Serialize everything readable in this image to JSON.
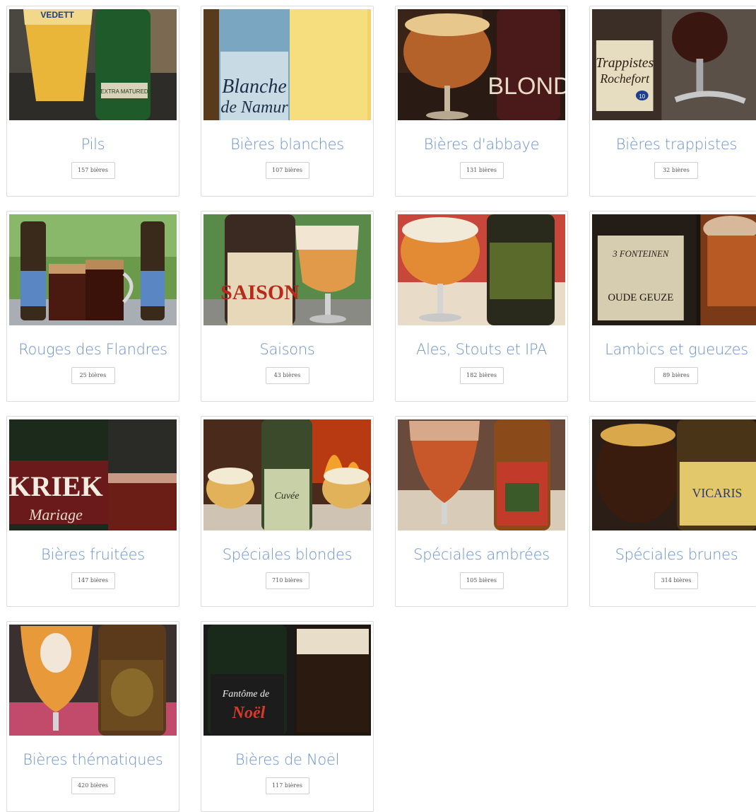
{
  "categories": [
    {
      "title": "Pils",
      "count": "157 bières"
    },
    {
      "title": "Bières blanches",
      "count": "107 bières"
    },
    {
      "title": "Bières d'abbaye",
      "count": "131 bières"
    },
    {
      "title": "Bières trappistes",
      "count": "32 bières"
    },
    {
      "title": "Rouges des Flandres",
      "count": "25 bières"
    },
    {
      "title": "Saisons",
      "count": "43 bières"
    },
    {
      "title": "Ales, Stouts et IPA",
      "count": "182 bières"
    },
    {
      "title": "Lambics et gueuzes",
      "count": "89 bières"
    },
    {
      "title": "Bières fruitées",
      "count": "147 bières"
    },
    {
      "title": "Spéciales blondes",
      "count": "710 bières"
    },
    {
      "title": "Spéciales ambrées",
      "count": "105 bières"
    },
    {
      "title": "Spéciales brunes",
      "count": "314 bières"
    },
    {
      "title": "Bières thématiques",
      "count": "420 bières"
    },
    {
      "title": "Bières de Noël",
      "count": "117 bières"
    }
  ],
  "photo_labels": {
    "pils_glass": "VEDETT",
    "pils_bottle": "EXTRA MATURED",
    "blanche_1": "Blanche",
    "blanche_2": "de Namur",
    "abbaye": "BLOND",
    "trappiste_1": "Trappistes",
    "trappiste_2": "Rochefort",
    "trappiste_3": "10",
    "saison": "SAISON",
    "lambic_1": "3 FONTEINEN",
    "lambic_2": "OUDE GEUZE",
    "kriek_1": "KRIEK",
    "kriek_2": "Mariage",
    "blonde": "Cuvée",
    "brune": "VICARIS",
    "noel_1": "Fantôme de",
    "noel_2": "Noël"
  }
}
